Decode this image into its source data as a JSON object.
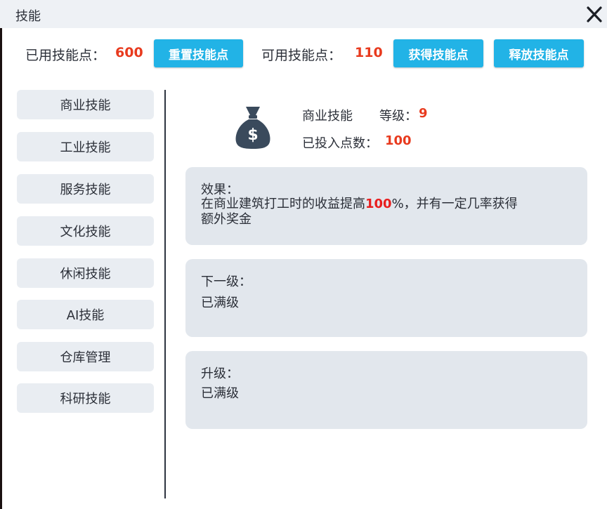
{
  "window": {
    "title": "技能"
  },
  "points": {
    "used_label": "已用技能点：",
    "used_value": "600",
    "reset_button": "重置技能点",
    "available_label": "可用技能点：",
    "available_value": "110",
    "get_button": "获得技能点",
    "release_button": "释放技能点"
  },
  "categories": [
    {
      "label": "商业技能"
    },
    {
      "label": "工业技能"
    },
    {
      "label": "服务技能"
    },
    {
      "label": "文化技能"
    },
    {
      "label": "休闲技能"
    },
    {
      "label": "AI技能"
    },
    {
      "label": "仓库管理"
    },
    {
      "label": "科研技能"
    }
  ],
  "skill": {
    "icon": "money-bag-icon",
    "name": "商业技能",
    "level_label": "等级：",
    "level_value": "9",
    "invested_label": "已投入点数：",
    "invested_value": "100"
  },
  "effect": {
    "title": "效果：",
    "text_before": "在商业建筑打工时的收益提高",
    "highlight": "100",
    "text_after_line1": "%，并有一定几率获得",
    "text_line2": "额外奖金"
  },
  "next_level": {
    "title": "下一级：",
    "value": "已满级"
  },
  "upgrade": {
    "title": "升级：",
    "value": "已满级"
  },
  "colors": {
    "accent_button": "#22b3e6",
    "highlight_number": "#e83a1e",
    "panel_bg": "#e2e7ed",
    "category_bg": "#e9edf2",
    "icon_dark": "#3a4a5c"
  }
}
